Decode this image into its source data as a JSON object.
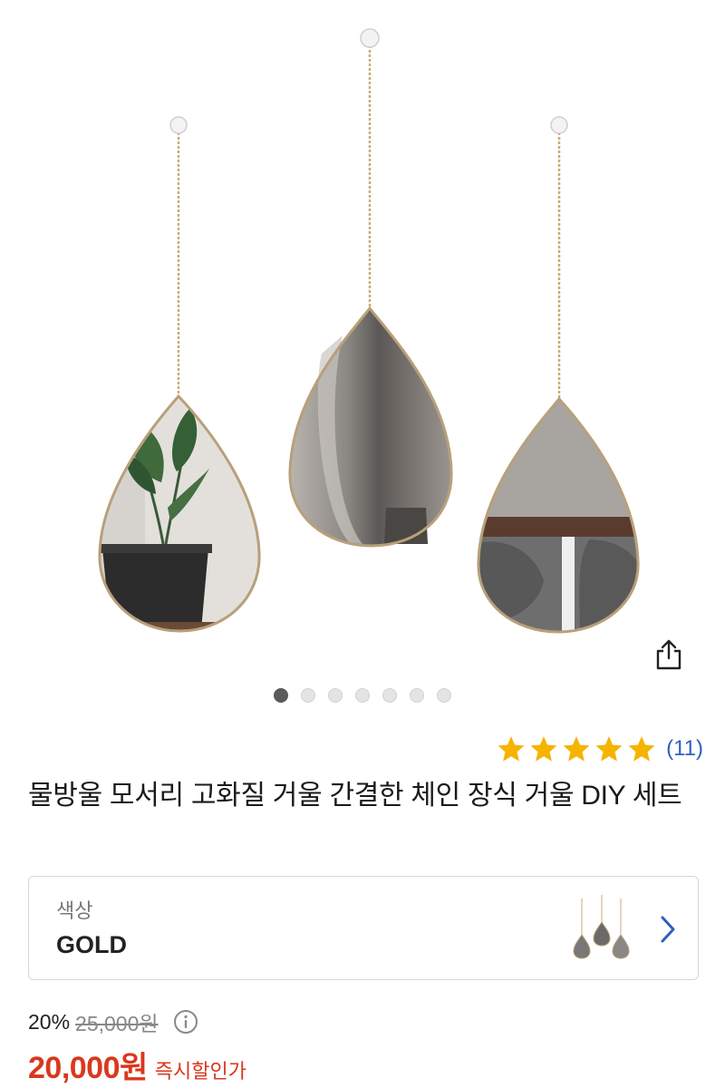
{
  "gallery": {
    "image_alt": "물방울 모서리 고화질 거울 세트 상품 이미지",
    "slide_count": 7,
    "active_slide": 1,
    "share_icon": "share-icon"
  },
  "rating": {
    "stars": 5,
    "review_count": "(11)",
    "star_color": "#f4b400"
  },
  "product": {
    "title": "물방울 모서리 고화질 거울 간결한 체인 장식 거울 DIY 세트"
  },
  "option": {
    "label": "색상",
    "value": "GOLD",
    "chevron_icon": "chevron-right-icon"
  },
  "price": {
    "discount_rate": "20%",
    "original_price": "25,000원",
    "sale_price": "20,000원",
    "sale_tag": "즉시할인가",
    "info_icon": "info-icon",
    "accent_color": "#d9381e"
  }
}
